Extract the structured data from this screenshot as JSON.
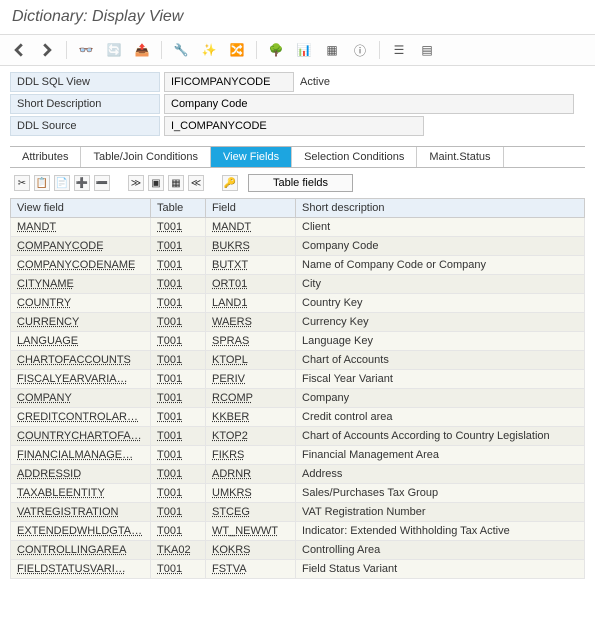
{
  "title": "Dictionary: Display View",
  "form": {
    "ddl_sql_view_label": "DDL SQL View",
    "ddl_sql_view_value": "IFICOMPANYCODE",
    "status": "Active",
    "short_desc_label": "Short Description",
    "short_desc_value": "Company Code",
    "ddl_source_label": "DDL Source",
    "ddl_source_value": "I_COMPANYCODE"
  },
  "tabs": {
    "attributes": "Attributes",
    "table_join": "Table/Join Conditions",
    "view_fields": "View Fields",
    "selection": "Selection Conditions",
    "maint": "Maint.Status"
  },
  "subtoolbar": {
    "table_fields_btn": "Table fields"
  },
  "grid": {
    "headers": {
      "view_field": "View field",
      "table": "Table",
      "field": "Field",
      "short_desc": "Short description"
    },
    "rows": [
      {
        "view_field": "MANDT",
        "table": "T001",
        "field": "MANDT",
        "desc": "Client"
      },
      {
        "view_field": "COMPANYCODE",
        "table": "T001",
        "field": "BUKRS",
        "desc": "Company Code"
      },
      {
        "view_field": "COMPANYCODENAME",
        "table": "T001",
        "field": "BUTXT",
        "desc": "Name of Company Code or Company"
      },
      {
        "view_field": "CITYNAME",
        "table": "T001",
        "field": "ORT01",
        "desc": "City"
      },
      {
        "view_field": "COUNTRY",
        "table": "T001",
        "field": "LAND1",
        "desc": "Country Key"
      },
      {
        "view_field": "CURRENCY",
        "table": "T001",
        "field": "WAERS",
        "desc": "Currency Key"
      },
      {
        "view_field": "LANGUAGE",
        "table": "T001",
        "field": "SPRAS",
        "desc": "Language Key"
      },
      {
        "view_field": "CHARTOFACCOUNTS",
        "table": "T001",
        "field": "KTOPL",
        "desc": "Chart of Accounts"
      },
      {
        "view_field": "FISCALYEARVARIA…",
        "table": "T001",
        "field": "PERIV",
        "desc": "Fiscal Year Variant"
      },
      {
        "view_field": "COMPANY",
        "table": "T001",
        "field": "RCOMP",
        "desc": "Company"
      },
      {
        "view_field": "CREDITCONTROLAR…",
        "table": "T001",
        "field": "KKBER",
        "desc": "Credit control area"
      },
      {
        "view_field": "COUNTRYCHARTOFA…",
        "table": "T001",
        "field": "KTOP2",
        "desc": "Chart of Accounts According to Country Legislation"
      },
      {
        "view_field": "FINANCIALMANAGE…",
        "table": "T001",
        "field": "FIKRS",
        "desc": "Financial Management Area"
      },
      {
        "view_field": "ADDRESSID",
        "table": "T001",
        "field": "ADRNR",
        "desc": "Address"
      },
      {
        "view_field": "TAXABLEENTITY",
        "table": "T001",
        "field": "UMKRS",
        "desc": "Sales/Purchases Tax Group"
      },
      {
        "view_field": "VATREGISTRATION",
        "table": "T001",
        "field": "STCEG",
        "desc": "VAT Registration Number"
      },
      {
        "view_field": "EXTENDEDWHLDGTA…",
        "table": "T001",
        "field": "WT_NEWWT",
        "desc": "Indicator: Extended Withholding Tax Active"
      },
      {
        "view_field": "CONTROLLINGAREA",
        "table": "TKA02",
        "field": "KOKRS",
        "desc": "Controlling Area"
      },
      {
        "view_field": "FIELDSTATUSVARI…",
        "table": "T001",
        "field": "FSTVA",
        "desc": "Field Status Variant"
      }
    ]
  }
}
